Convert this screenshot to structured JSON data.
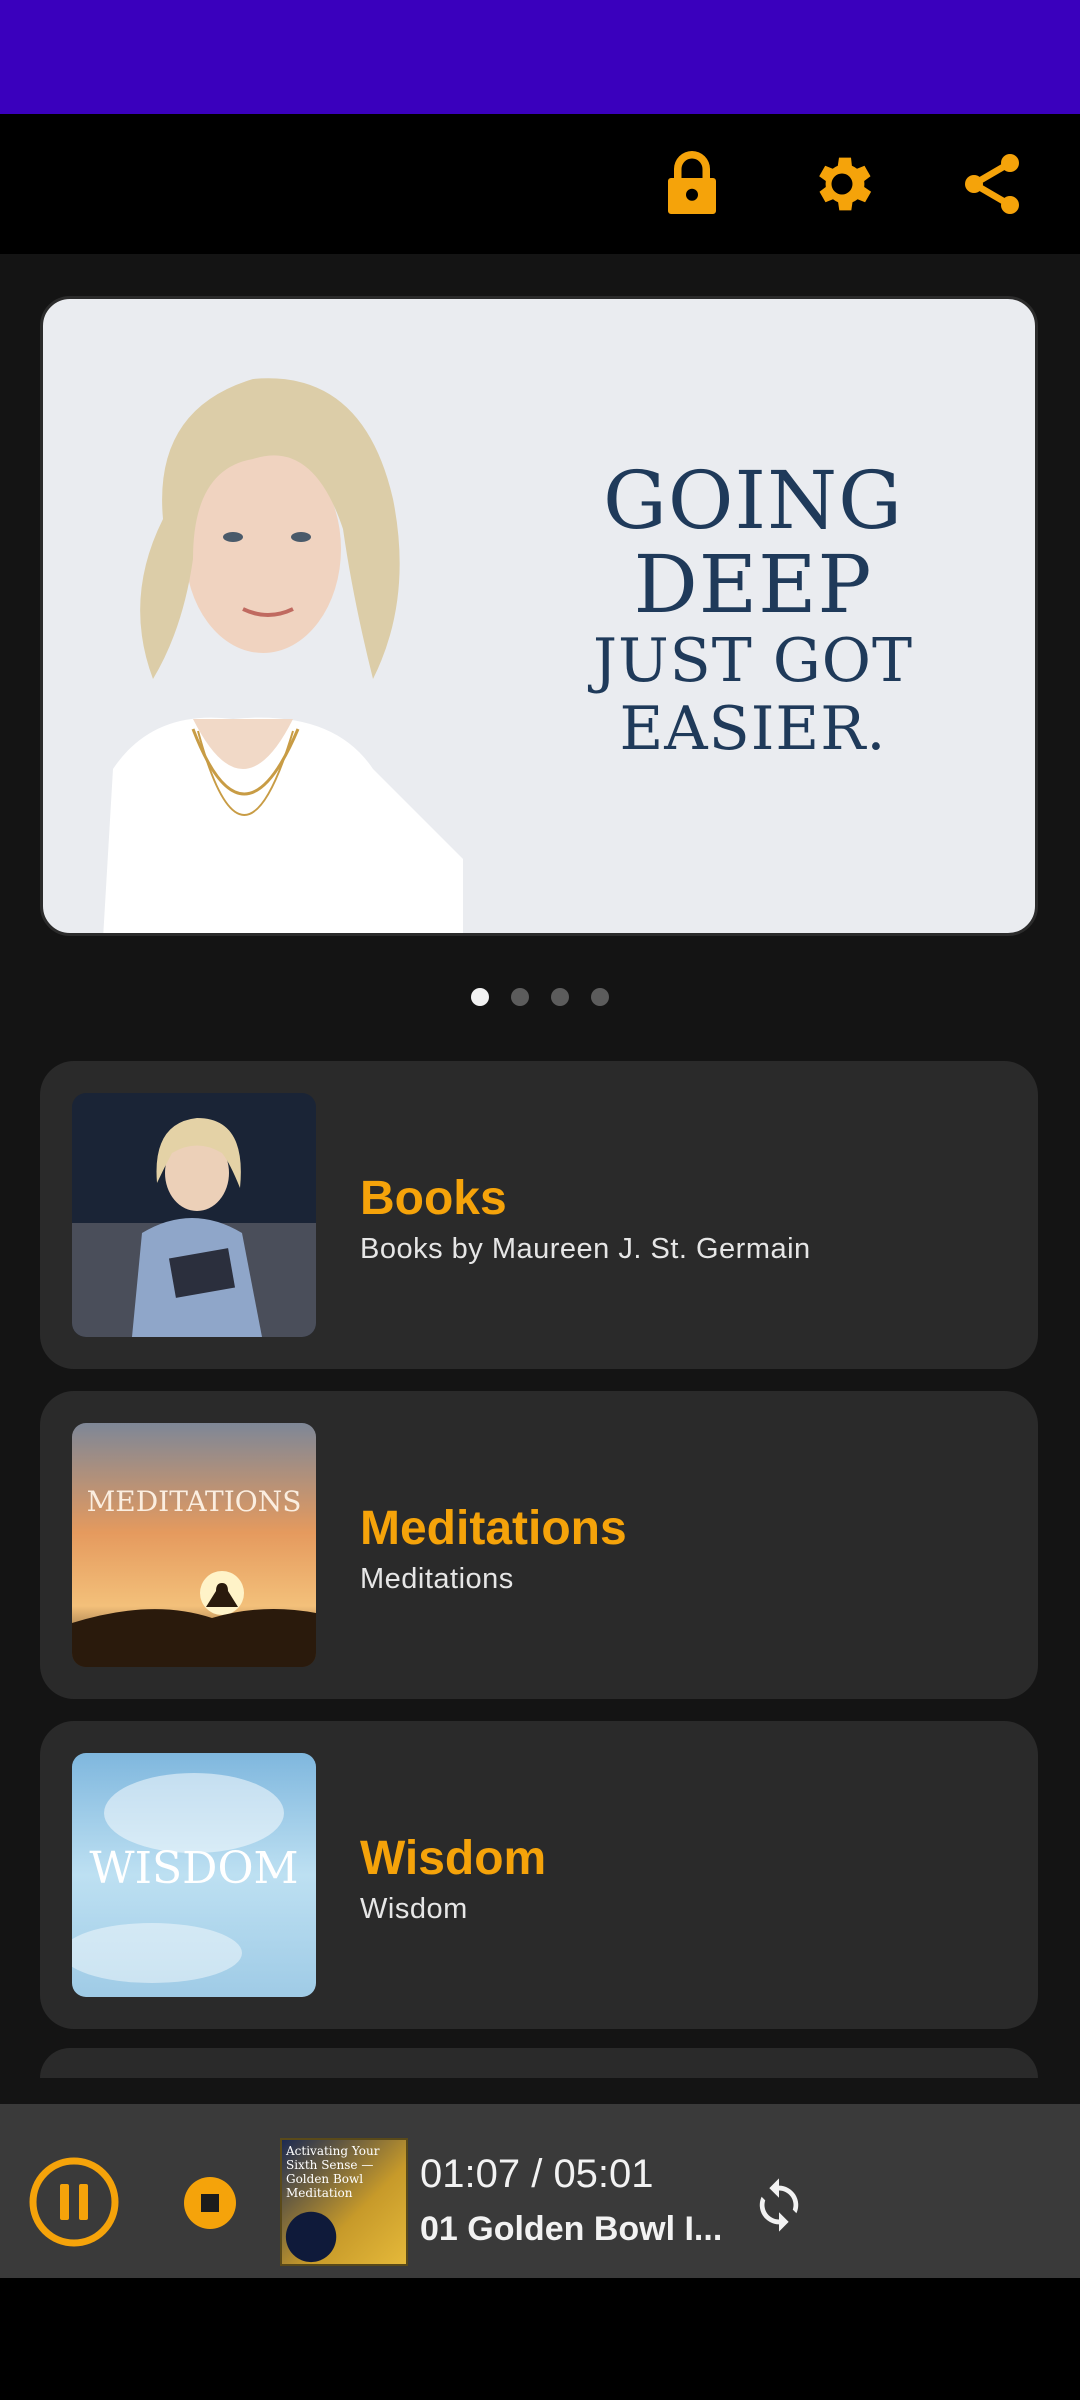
{
  "colors": {
    "accent": "#f5a30a",
    "status_bar": "#3a00bd",
    "card_bg": "#2a2a2a",
    "background": "#141414"
  },
  "toolbar": {
    "icons": [
      "lock-icon",
      "gear-icon",
      "share-icon"
    ]
  },
  "banner": {
    "line1": "GOING DEEP",
    "line2": "JUST GOT EASIER.",
    "page_count": 4,
    "active_page": 1
  },
  "categories": [
    {
      "title": "Books",
      "subtitle": "Books by Maureen J. St. Germain"
    },
    {
      "title": "Meditations",
      "subtitle": "Meditations",
      "thumb_text": "MEDITATIONS"
    },
    {
      "title": "Wisdom",
      "subtitle": "Wisdom",
      "thumb_text": "WISDOM"
    }
  ],
  "player": {
    "time": "01:07 / 05:01",
    "track": "01 Golden Bowl I...",
    "cover_text": "Activating Your Sixth Sense — Golden Bowl Meditation"
  }
}
